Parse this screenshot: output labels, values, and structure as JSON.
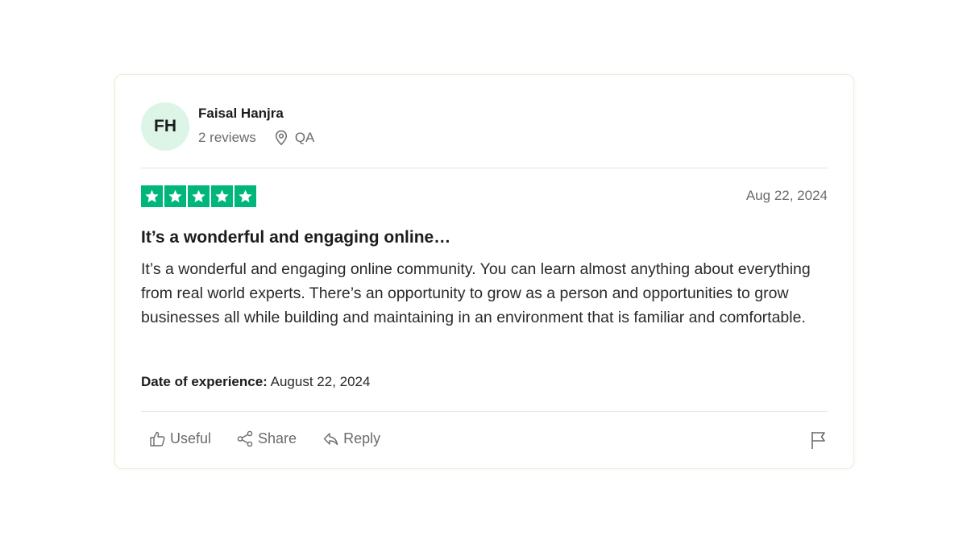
{
  "reviewer": {
    "initials": "FH",
    "name": "Faisal Hanjra",
    "reviews_count": "2 reviews",
    "location": "QA"
  },
  "review": {
    "rating": 5,
    "max_rating": 5,
    "star_color": "#00b67a",
    "date": "Aug 22, 2024",
    "title": "It’s a wonderful and engaging online…",
    "body": "It’s a wonderful and engaging online community. You can learn almost anything about everything from real world experts. There’s an opportunity to grow as a person and opportunities to grow businesses all while building and maintaining in an environment that is familiar and comfortable.",
    "experience_label": "Date of experience:",
    "experience_date": "August 22, 2024"
  },
  "actions": {
    "useful": "Useful",
    "share": "Share",
    "reply": "Reply"
  },
  "colors": {
    "avatar_bg": "#dcf5e7",
    "muted_text": "#6b6b6b"
  }
}
